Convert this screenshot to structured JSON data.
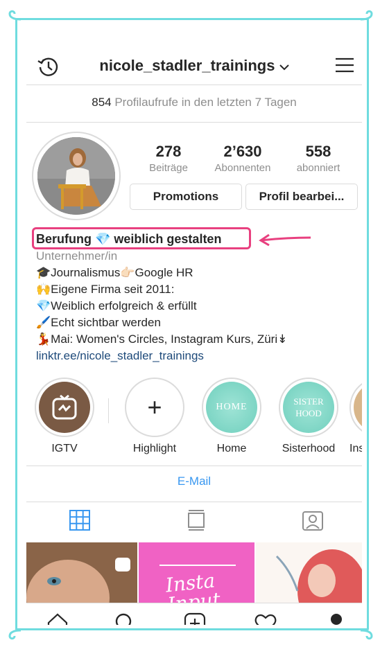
{
  "header": {
    "username": "nicole_stadler_trainings",
    "chevron": "⌄"
  },
  "views": {
    "count": "854",
    "text": "Profilaufrufe in den letzten 7 Tagen"
  },
  "stats": [
    {
      "num": "278",
      "label": "Beiträge"
    },
    {
      "num": "2’630",
      "label": "Abonnenten"
    },
    {
      "num": "558",
      "label": "abonniert"
    }
  ],
  "buttons": {
    "promotions": "Promotions",
    "edit": "Profil bearbei..."
  },
  "bio": {
    "name": "Berufung 💎 weiblich gestalten",
    "category": "Unternehmer/in",
    "lines": [
      "🎓Journalismus👉🏻Google HR",
      "🙌Eigene Firma seit 2011:",
      "💎Weiblich erfolgreich & erfüllt",
      "🖌️Echt sichtbar werden",
      "💃Mai: Women's Circles, Instagram Kurs, Züri↡"
    ],
    "link": "linktr.ee/nicole_stadler_trainings"
  },
  "highlights": [
    {
      "label": "IGTV",
      "inner_text": ""
    },
    {
      "label": "Highlight",
      "inner_text": "+"
    },
    {
      "label": "Home",
      "inner_text": "HOME"
    },
    {
      "label": "Sisterhood",
      "inner_text": "SISTER HOOD"
    },
    {
      "label": "Ins",
      "inner_text": ""
    }
  ],
  "email": "E-Mail",
  "grid": {
    "post2_text": "Insta Input"
  },
  "colors": {
    "accent": "#3897f0",
    "highlight_box": "#e8407f",
    "frame": "#6fdcdf",
    "teal": "#7fd6c6",
    "pink_post": "#f062c4"
  }
}
